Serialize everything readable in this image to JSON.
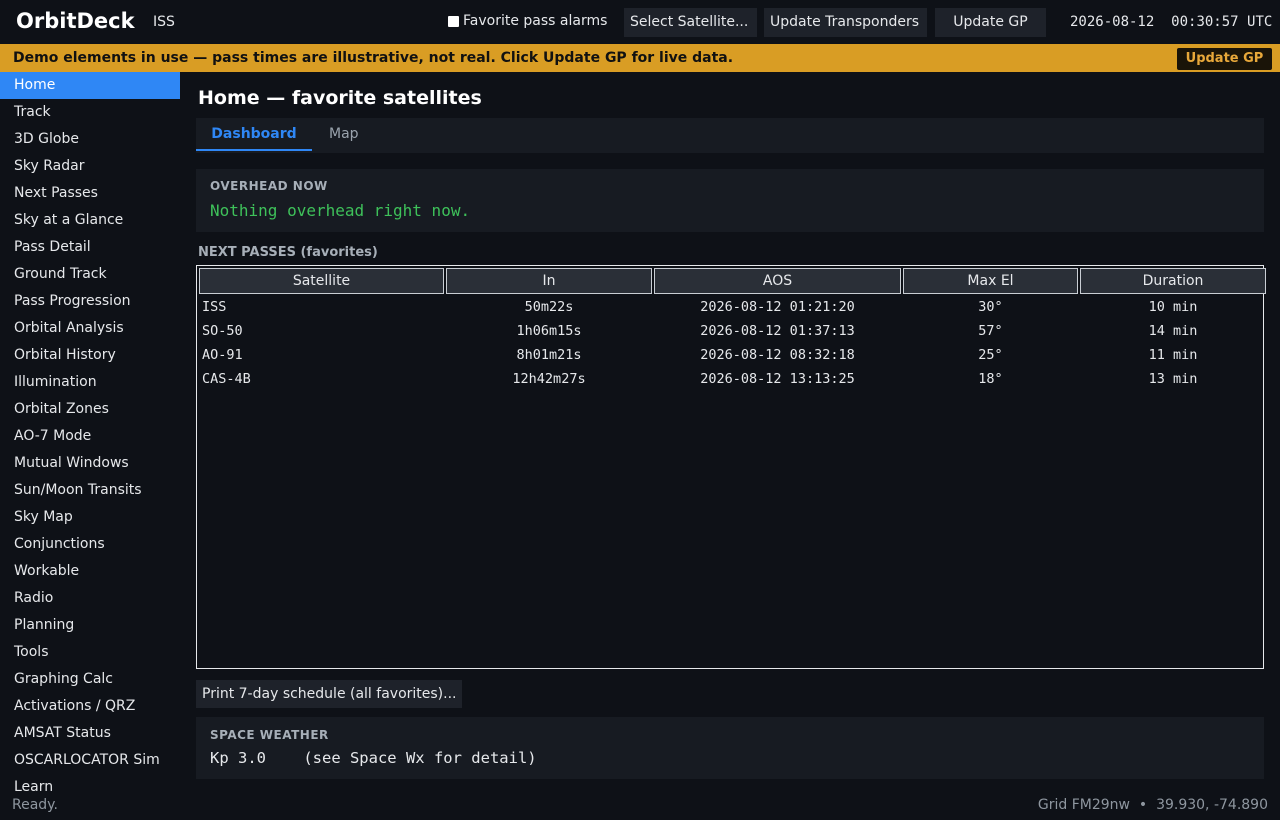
{
  "header": {
    "app_title": "OrbitDeck",
    "current_satellite": "ISS",
    "alarms_label": "Favorite pass alarms",
    "select_satellite": "Select Satellite...",
    "update_transponders": "Update Transponders",
    "update_gp": "Update GP",
    "date": "2026-08-12",
    "time": "00:30:57 UTC"
  },
  "banner": {
    "text": "Demo elements in use — pass times are illustrative, not real. Click Update GP for live data.",
    "button": "Update GP",
    "color": "#d99d24"
  },
  "sidebar": {
    "active_color": "#2f87f5",
    "items": [
      {
        "label": "Home",
        "active": true
      },
      {
        "label": "Track"
      },
      {
        "label": "3D Globe"
      },
      {
        "label": "Sky Radar"
      },
      {
        "label": "Next Passes"
      },
      {
        "label": "Sky at a Glance"
      },
      {
        "label": "Pass Detail"
      },
      {
        "label": "Ground Track"
      },
      {
        "label": "Pass Progression"
      },
      {
        "label": "Orbital Analysis"
      },
      {
        "label": "Orbital History"
      },
      {
        "label": "Illumination"
      },
      {
        "label": "Orbital Zones"
      },
      {
        "label": "AO-7 Mode"
      },
      {
        "label": "Mutual Windows"
      },
      {
        "label": "Sun/Moon Transits"
      },
      {
        "label": "Sky Map"
      },
      {
        "label": "Conjunctions"
      },
      {
        "label": "Workable"
      },
      {
        "label": "Radio"
      },
      {
        "label": "Planning"
      },
      {
        "label": "Tools"
      },
      {
        "label": "Graphing Calc"
      },
      {
        "label": "Activations / QRZ"
      },
      {
        "label": "AMSAT Status"
      },
      {
        "label": "OSCARLOCATOR Sim"
      },
      {
        "label": "Learn"
      }
    ]
  },
  "main": {
    "title": "Home — favorite satellites",
    "tabs": [
      {
        "label": "Dashboard",
        "active": true
      },
      {
        "label": "Map"
      }
    ],
    "overhead": {
      "heading": "OVERHEAD NOW",
      "message": "Nothing overhead right now."
    },
    "next_passes": {
      "heading": "NEXT PASSES (favorites)",
      "columns": [
        "Satellite",
        "In",
        "AOS",
        "Max El",
        "Duration"
      ],
      "rows": [
        [
          "ISS",
          "50m22s",
          "2026-08-12 01:21:20",
          "30°",
          "10 min"
        ],
        [
          "SO-50",
          "1h06m15s",
          "2026-08-12 01:37:13",
          "57°",
          "14 min"
        ],
        [
          "AO-91",
          "8h01m21s",
          "2026-08-12 08:32:18",
          "25°",
          "11 min"
        ],
        [
          "CAS-4B",
          "12h42m27s",
          "2026-08-12 13:13:25",
          "18°",
          "13 min"
        ]
      ]
    },
    "print_button": "Print 7-day schedule (all favorites)...",
    "space_weather": {
      "heading": "SPACE WEATHER",
      "value": "Kp 3.0    (see Space Wx for detail)"
    }
  },
  "status": {
    "left": "Ready.",
    "grid": "Grid FM29nw",
    "separator": "•",
    "coords": "39.930, -74.890"
  }
}
